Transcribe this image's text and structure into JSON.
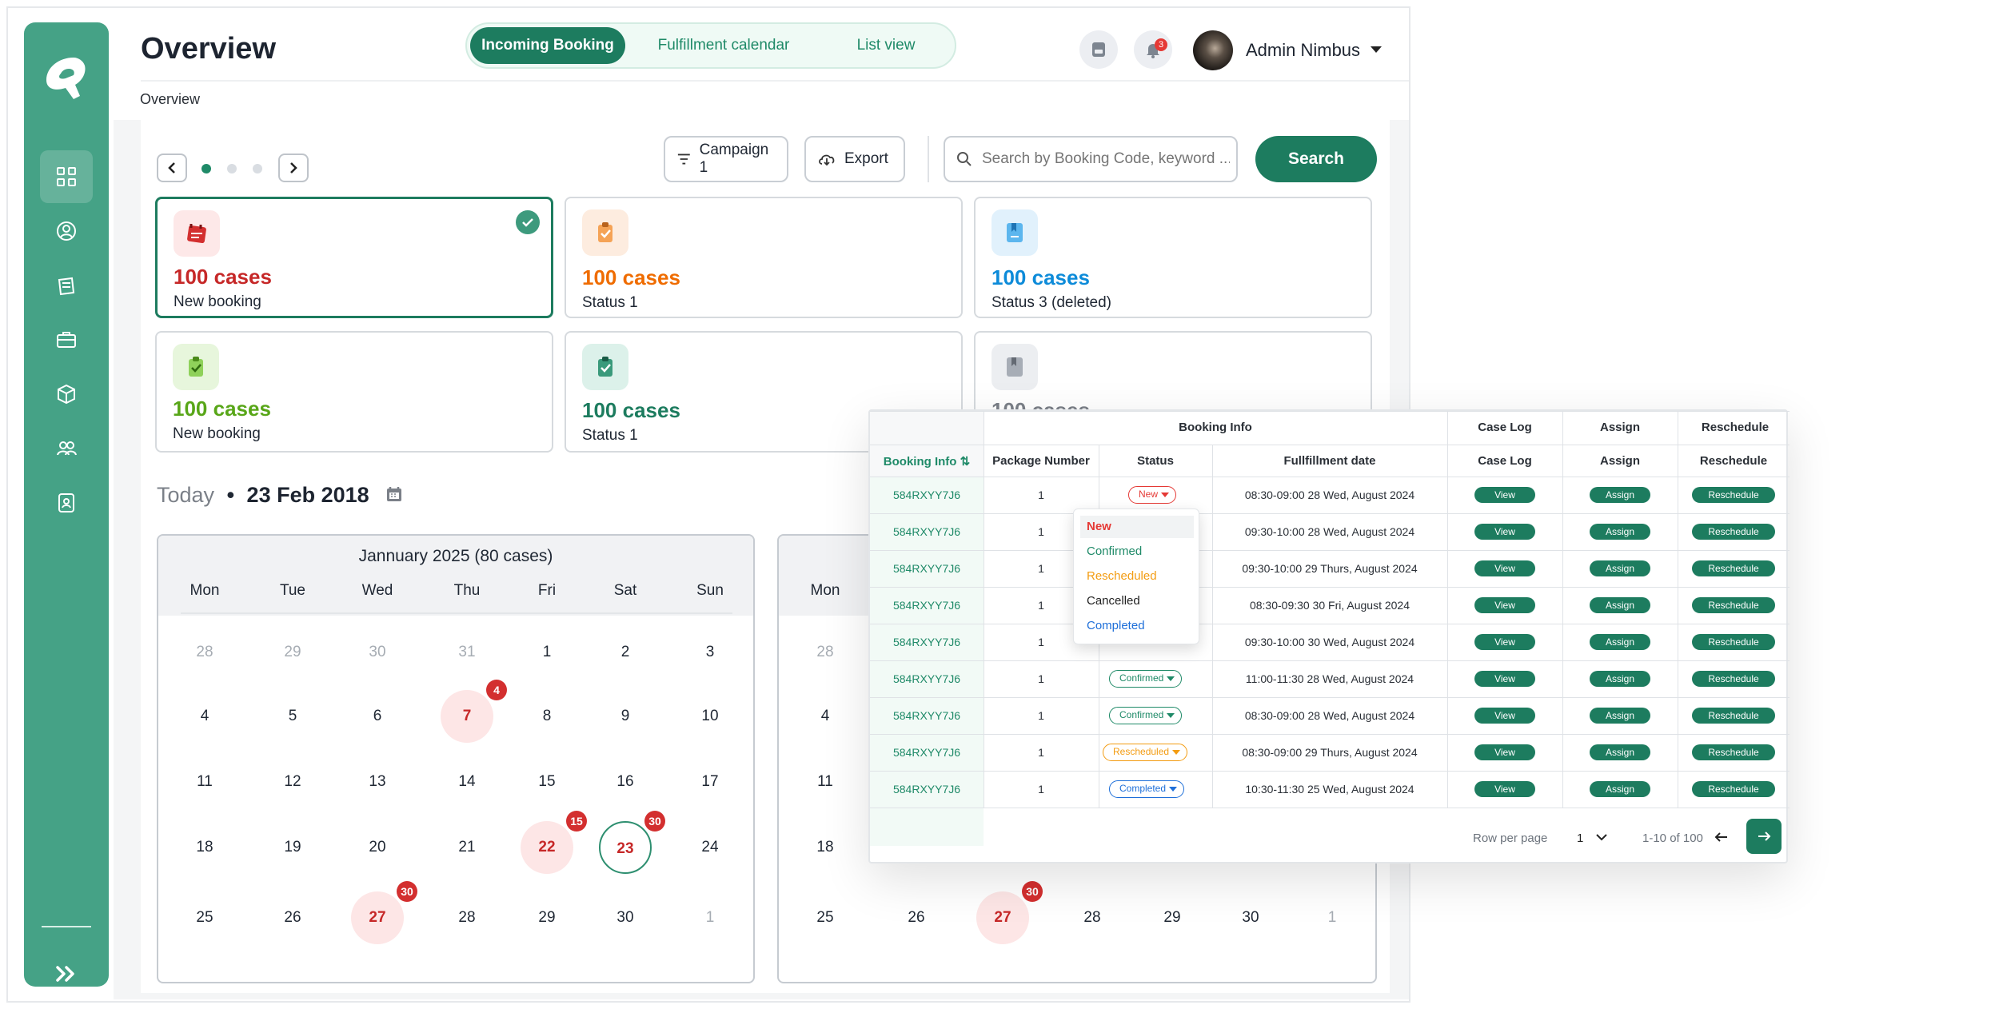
{
  "app": {
    "title": "Overview",
    "breadcrumb": "Overview"
  },
  "colors": {
    "primary": "#1d7c5f",
    "sidebar": "#45a286",
    "red": "#c62828",
    "orange": "#ef6c00",
    "blue": "#0d8bd9",
    "green": "#58a618",
    "teal": "#1d7c5f"
  },
  "tabs": [
    {
      "label": "Incoming Booking",
      "active": true
    },
    {
      "label": "Fulfillment calendar"
    },
    {
      "label": "List view"
    }
  ],
  "user": {
    "name": "Admin Nimbus",
    "notifications": "3"
  },
  "sidebar": [
    "grid-icon",
    "user-circle-icon",
    "notebook-icon",
    "briefcase-icon",
    "box-icon",
    "people-icon",
    "id-badge-icon"
  ],
  "toolbar": {
    "campaign": "Campaign 1",
    "export": "Export",
    "search_placeholder": "Search by Booking Code, keyword ...",
    "search": "Search"
  },
  "cards": [
    {
      "value": "100 cases",
      "label": "New booking",
      "color": "#c62828",
      "icon": "calendar-icon",
      "selected": true
    },
    {
      "value": "100 cases",
      "label": "Status 1",
      "color": "#ef6c00",
      "icon": "clipboard-check-icon"
    },
    {
      "value": "100 cases",
      "label": "Status 3 (deleted)",
      "color": "#0d8bd9",
      "icon": "bookmark-icon"
    },
    {
      "value": "100 cases",
      "label": "New booking",
      "color": "#58a618",
      "icon": "clipboard-check-icon"
    },
    {
      "value": "100 cases",
      "label": "Status 1",
      "color": "#1d7c5f",
      "icon": "clipboard-check-icon"
    },
    {
      "value": "100 cases",
      "label": "",
      "color": "#7b8088",
      "icon": "bookmark-icon"
    }
  ],
  "today": {
    "label": "Today",
    "dot": "•",
    "date": "23 Feb 2018"
  },
  "calendar": {
    "title": "Jannuary 2025 (80 cases)",
    "days": [
      "Mon",
      "Tue",
      "Wed",
      "Thu",
      "Fri",
      "Sat",
      "Sun"
    ],
    "weeks": [
      [
        "28",
        "29",
        "30",
        "31",
        "1",
        "2",
        "3"
      ],
      [
        "4",
        "5",
        "6",
        "7",
        "8",
        "9",
        "10"
      ],
      [
        "11",
        "12",
        "13",
        "14",
        "15",
        "16",
        "17"
      ],
      [
        "18",
        "19",
        "20",
        "21",
        "22",
        "23",
        "24"
      ],
      [
        "25",
        "26",
        "27",
        "28",
        "29",
        "30",
        "1"
      ]
    ],
    "badges": {
      "7": "4",
      "22": "15",
      "23": "30",
      "27": "30"
    }
  },
  "calendar2": {
    "visible_days": [
      "Mon"
    ],
    "col1": [
      "28",
      "4",
      "11",
      "18",
      "25"
    ],
    "visible": {
      "26": "26",
      "27": "27",
      "28": "28",
      "29": "29",
      "30": "30",
      "1": "1"
    },
    "badge27": "30"
  },
  "table": {
    "group_header": "Booking Info",
    "headers": [
      "Booking Info",
      "Package Number",
      "Status",
      "Fullfillment date",
      "Case Log",
      "Assign",
      "Reschedule"
    ],
    "top_headers": [
      "Case Log",
      "Assign",
      "Reschedule"
    ],
    "rows": [
      {
        "code": "584RXYY7J6",
        "pkg": "1",
        "status": "New",
        "date": "08:30-09:00 28 Wed, August 2024"
      },
      {
        "code": "584RXYY7J6",
        "pkg": "1",
        "status": "",
        "date": "09:30-10:00 28 Wed, August 2024"
      },
      {
        "code": "584RXYY7J6",
        "pkg": "1",
        "status": "",
        "date": "09:30-10:00 29 Thurs, August 2024"
      },
      {
        "code": "584RXYY7J6",
        "pkg": "1",
        "status": "",
        "date": "08:30-09:30 30 Fri, August 2024"
      },
      {
        "code": "584RXYY7J6",
        "pkg": "1",
        "status": "",
        "date": "09:30-10:00 30 Wed, August 2024"
      },
      {
        "code": "584RXYY7J6",
        "pkg": "1",
        "status": "Confirmed",
        "date": "11:00-11:30 28 Wed, August 2024"
      },
      {
        "code": "584RXYY7J6",
        "pkg": "1",
        "status": "Confirmed",
        "date": "08:30-09:00 28 Wed, August 2024"
      },
      {
        "code": "584RXYY7J6",
        "pkg": "1",
        "status": "Rescheduled",
        "date": "08:30-09:00 29 Thurs, August 2024"
      },
      {
        "code": "584RXYY7J6",
        "pkg": "1",
        "status": "Completed",
        "date": "10:30-11:30 25 Wed, August 2024"
      }
    ],
    "actions": {
      "view": "View",
      "assign": "Assign",
      "reschedule": "Reschedule"
    },
    "dropdown": [
      "New",
      "Confirmed",
      "Rescheduled",
      "Cancelled",
      "Completed"
    ],
    "footer": {
      "rows_label": "Row per page",
      "rows_value": "1",
      "range": "1-10 of 100"
    }
  }
}
